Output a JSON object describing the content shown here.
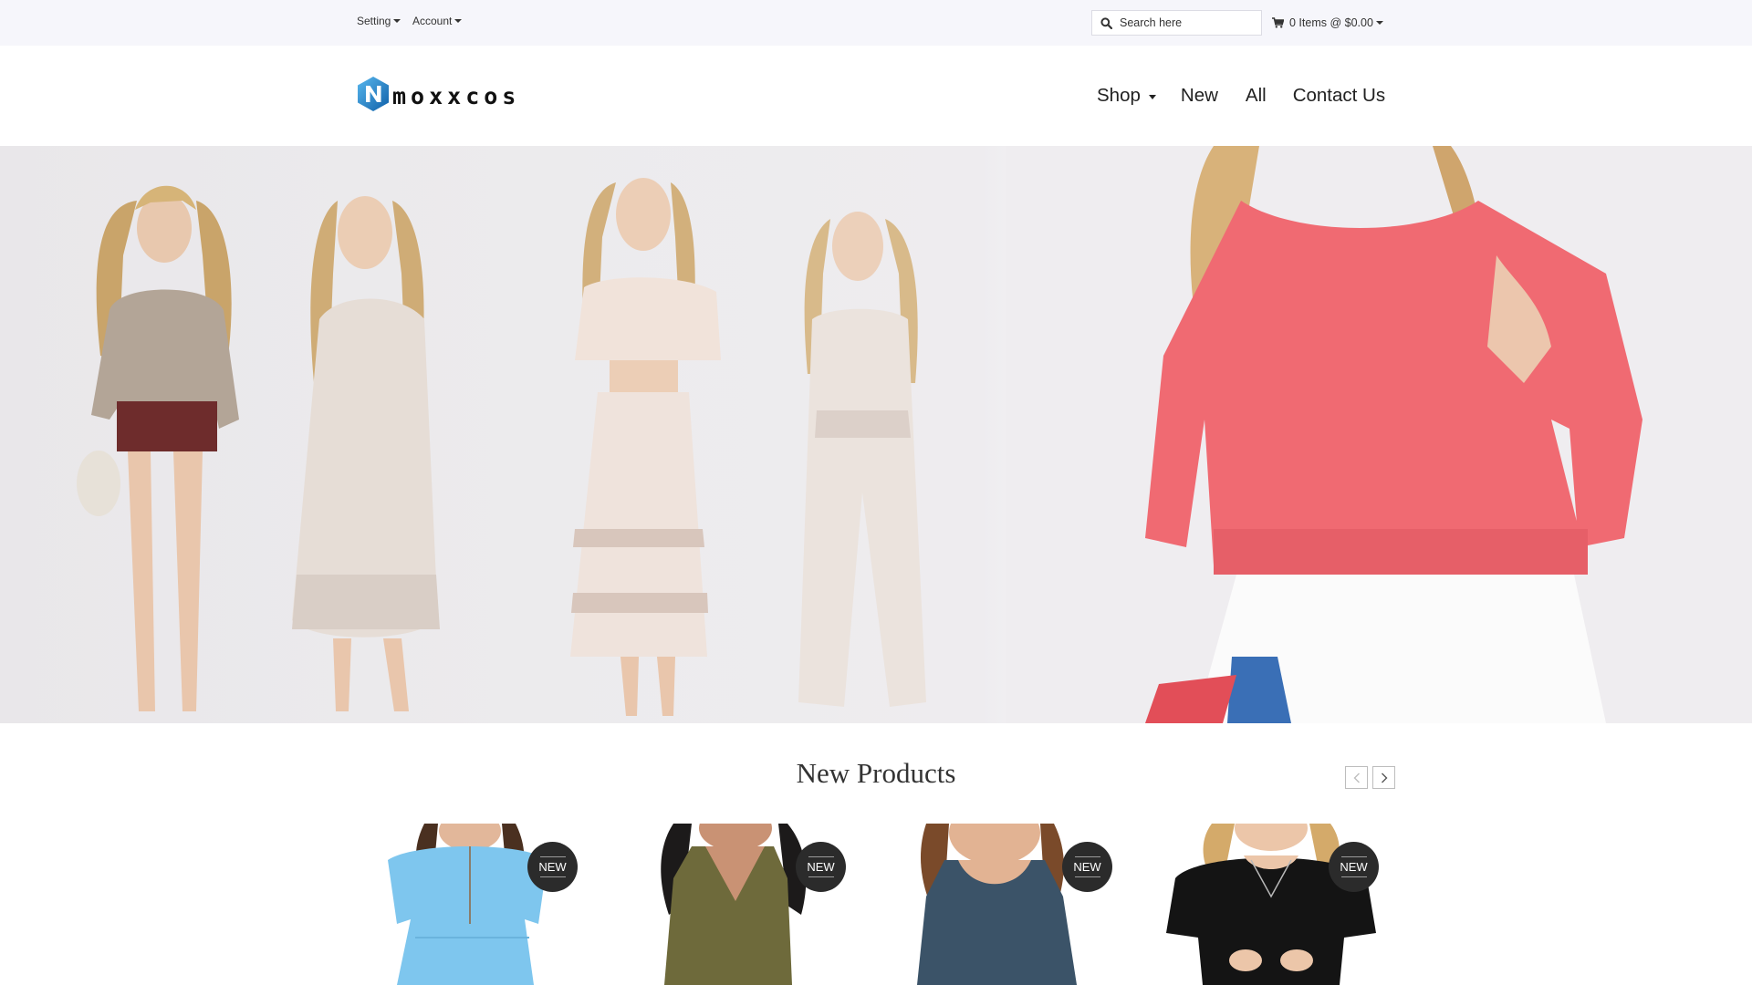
{
  "topbar": {
    "setting_label": "Setting",
    "account_label": "Account",
    "search_placeholder": "Search here",
    "cart_label": "0 Items @ $0.00"
  },
  "header": {
    "logo_text": "moxxcos",
    "nav": {
      "shop": "Shop",
      "new": "New",
      "all": "All",
      "contact": "Contact Us"
    }
  },
  "section": {
    "title": "New Products"
  },
  "products": [
    {
      "badge": "NEW",
      "garment": "Light blue short-sleeve dress with necklace",
      "color": "#7ec6ee"
    },
    {
      "badge": "NEW",
      "garment": "Olive v-neck tank top",
      "color": "#6e6a3b"
    },
    {
      "badge": "NEW",
      "garment": "Slate blue scoop-neck tank top",
      "color": "#3b5368"
    },
    {
      "badge": "NEW",
      "garment": "Black short-sleeve tee with necklace",
      "color": "#141414"
    }
  ],
  "hero": {
    "left_description": "Four models in cream and lace summer outfits",
    "right_description": "Close-up of a model in a coral knit sweater and white skirt",
    "accent_color": "#f06a72"
  },
  "icons": [
    "caret-down-icon",
    "search-icon",
    "cart-icon",
    "chevron-left-icon",
    "chevron-right-icon"
  ]
}
